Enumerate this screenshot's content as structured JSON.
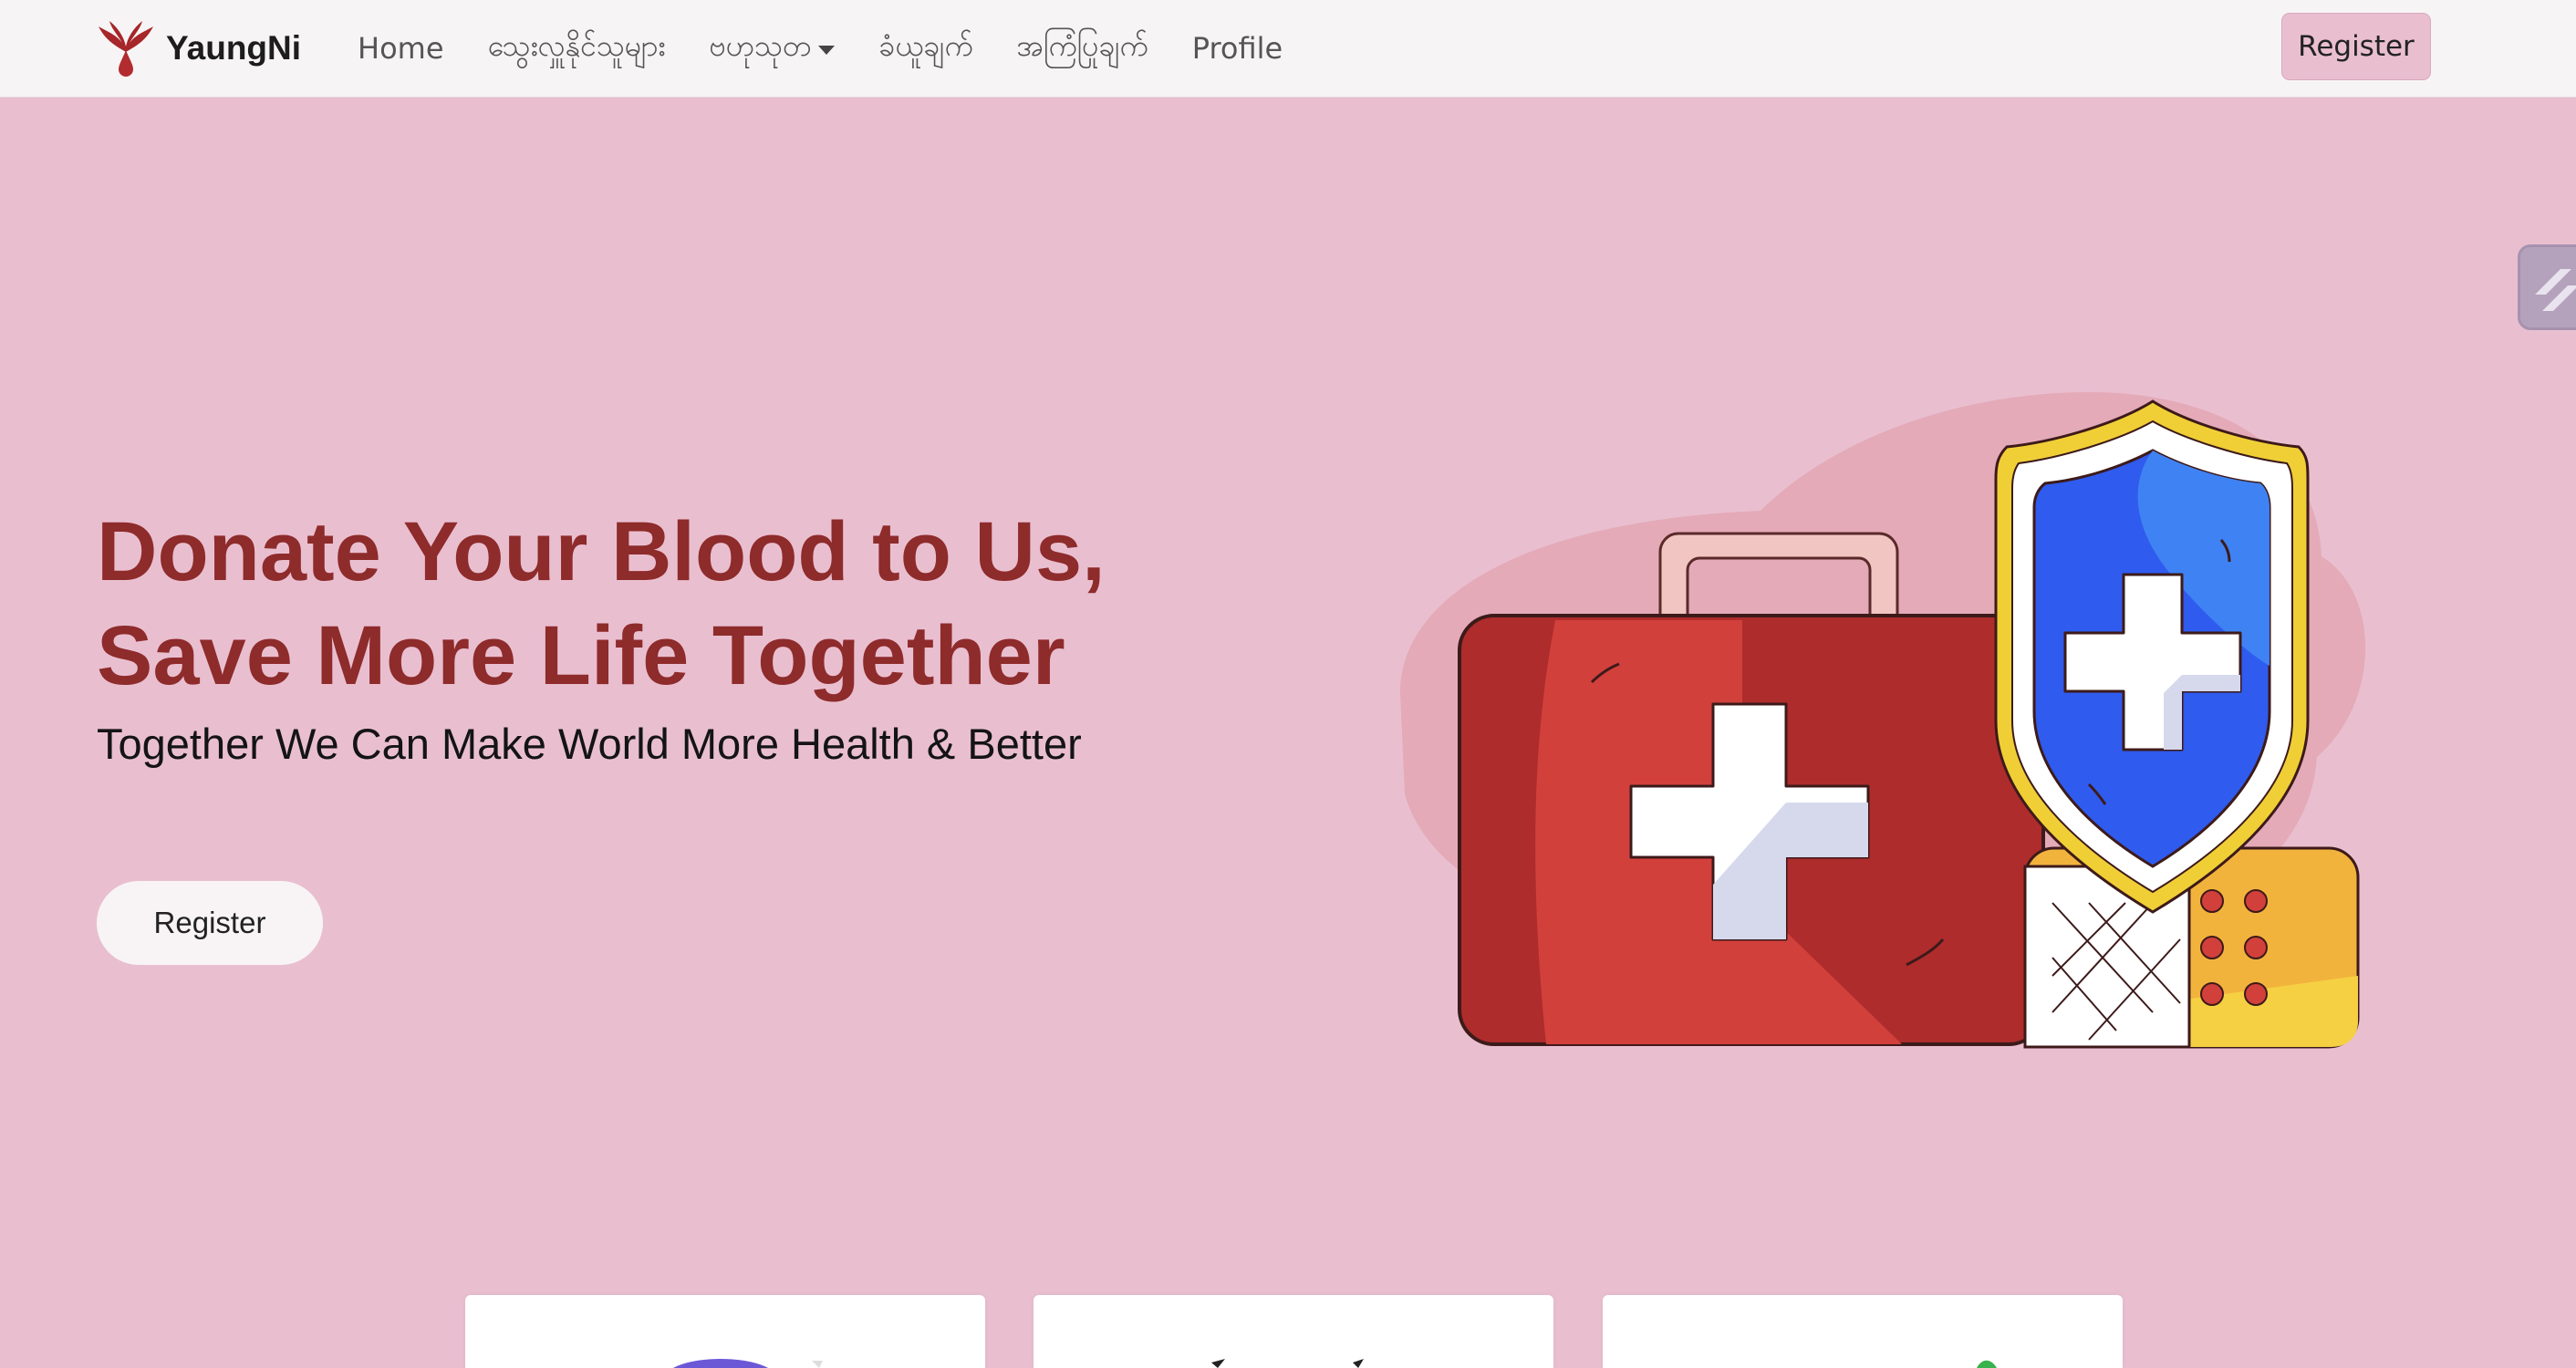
{
  "navbar": {
    "brand": "YaungNi",
    "links": [
      {
        "label": "Home"
      },
      {
        "label": "သွေးလှူနိုင်သူများ"
      },
      {
        "label": "ဗဟုသုတ",
        "dropdown": true
      },
      {
        "label": "ခံယူချက်"
      },
      {
        "label": "အကြံပြုချက်"
      },
      {
        "label": "Profile"
      }
    ],
    "register_label": "Register"
  },
  "hero": {
    "title_line1": "Donate Your Blood to Us,",
    "title_line2": "Save More Life Together",
    "subtitle": "Together We Can Make World More Health & Better",
    "register_label": "Register"
  },
  "colors": {
    "background": "#e9bfd0",
    "navbar": "#f7f4f5",
    "title": "#8e2b2b",
    "kit_red": "#d2403c",
    "shield_blue": "#3a6cf0",
    "bandage_yellow": "#f2b33d"
  },
  "icons": {
    "brand": "blood-drop-wings-icon",
    "side_widget": "extension-widget-icon"
  }
}
